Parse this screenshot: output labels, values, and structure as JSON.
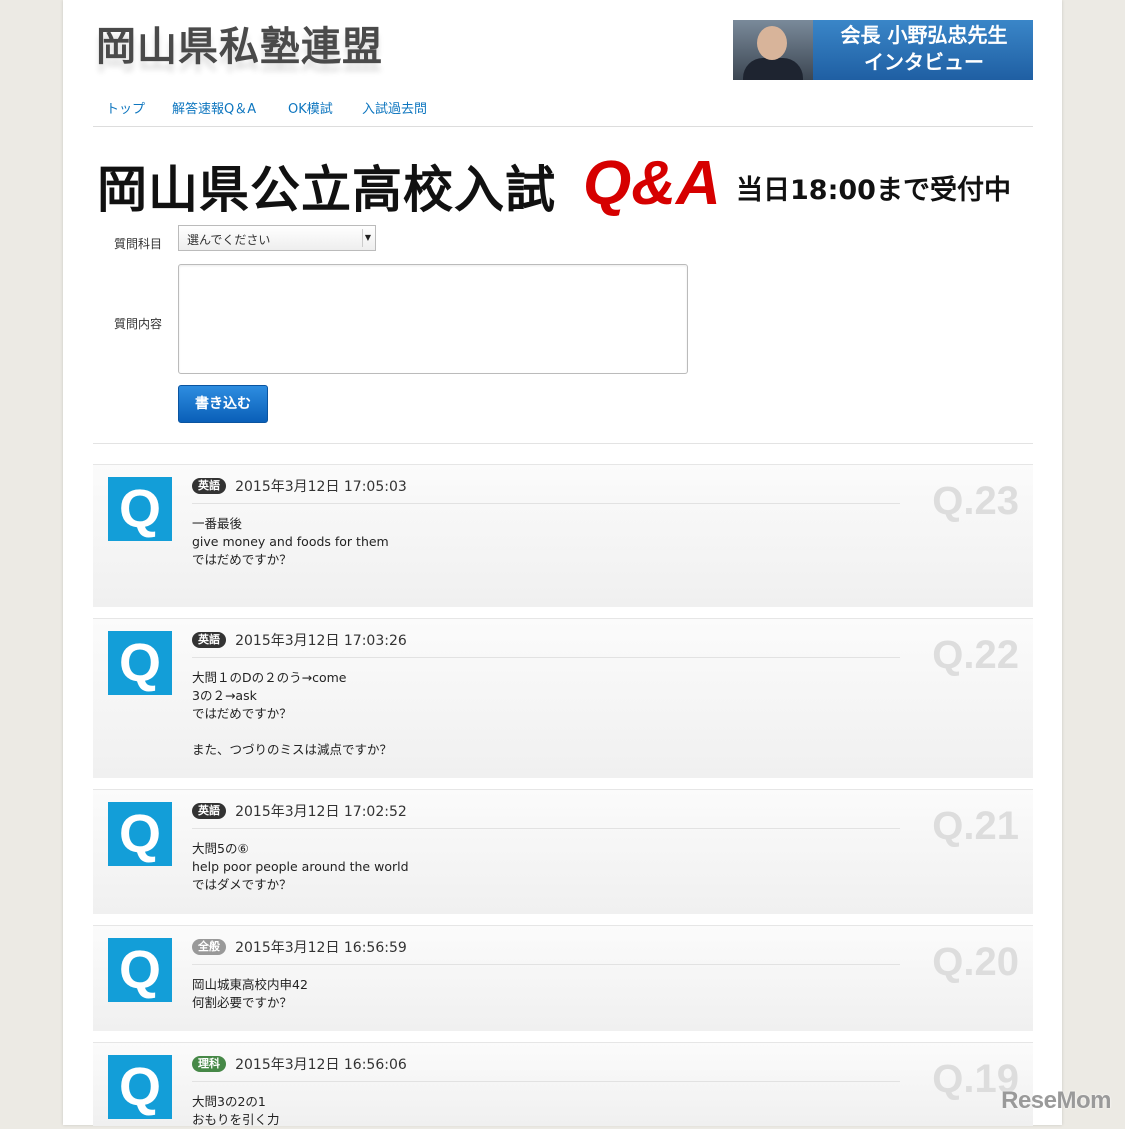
{
  "header": {
    "logo_text": "岡山県私塾連盟",
    "banner_line1": "会長 小野弘忠先生",
    "banner_line2": "インタビュー"
  },
  "nav": [
    {
      "label": "トップ"
    },
    {
      "label": "解答速報Q＆A"
    },
    {
      "label": "OK模試"
    },
    {
      "label": "入試過去問"
    }
  ],
  "title": {
    "main": "岡山県公立高校入試",
    "qa": "Q&A",
    "sub": "当日18:00まで受付中"
  },
  "form": {
    "subject_label": "質問科目",
    "subject_value": "選んでください",
    "content_label": "質問内容",
    "submit_label": "書き込む"
  },
  "colors": {
    "english_badge": "#333333",
    "general_badge": "#999999",
    "science_badge": "#468847",
    "q_icon": "#139ed8",
    "nav_link": "#0e76bf",
    "qa_red": "#d60000"
  },
  "questions": [
    {
      "icon": "Q",
      "subject": "英語",
      "date": "2015年3月12日 17:05:03",
      "number": "Q.23",
      "lines": [
        "一番最後",
        "give money and foods for them",
        "ではだめですか？"
      ]
    },
    {
      "icon": "Q",
      "subject": "英語",
      "date": "2015年3月12日 17:03:26",
      "number": "Q.22",
      "lines": [
        "大問１のDの２のう→come",
        "3の２→ask",
        "ではだめですか？",
        "",
        "また、つづりのミスは減点ですか？"
      ]
    },
    {
      "icon": "Q",
      "subject": "英語",
      "date": "2015年3月12日 17:02:52",
      "number": "Q.21",
      "lines": [
        "大問5の⑥",
        "help poor people around the world",
        "ではダメですか？"
      ]
    },
    {
      "icon": "Q",
      "subject": "全般",
      "date": "2015年3月12日 16:56:59",
      "number": "Q.20",
      "lines": [
        "岡山城東高校内申42",
        "何割必要ですか？"
      ]
    },
    {
      "icon": "Q",
      "subject": "理科",
      "date": "2015年3月12日 16:56:06",
      "number": "Q.19",
      "lines": [
        "大問3の2の1",
        "おもりを引く力"
      ]
    }
  ],
  "watermark": "ReseMom"
}
